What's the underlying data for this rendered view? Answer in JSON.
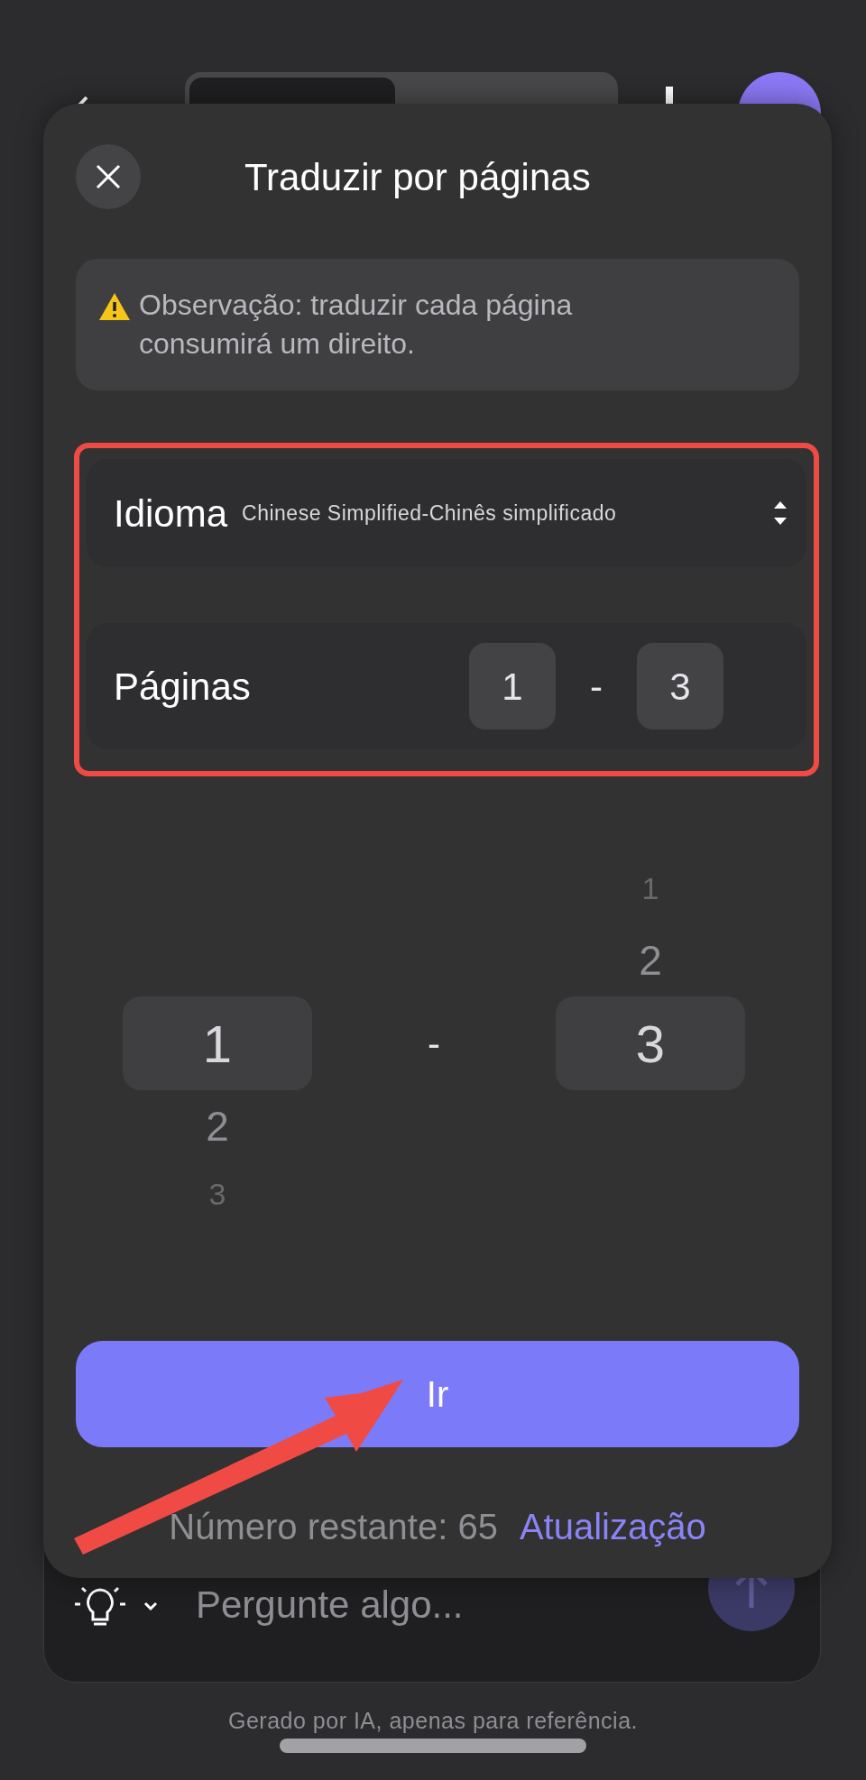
{
  "sheet": {
    "title": "Traduzir por páginas",
    "notice": "Observação: traduzir cada página consumirá um direito.",
    "language": {
      "label": "Idioma",
      "value": "Chinese Simplified-Chinês simplificado"
    },
    "pages": {
      "label": "Páginas",
      "from": "1",
      "separator": "-",
      "to": "3"
    },
    "picker": {
      "separator": "-",
      "columns": [
        {
          "items": [
            {
              "label": "1",
              "selected": true
            },
            {
              "label": "2",
              "selected": false
            },
            {
              "label": "3",
              "selected": false
            }
          ]
        },
        {
          "items": [
            {
              "label": "1",
              "selected": false
            },
            {
              "label": "2",
              "selected": false
            },
            {
              "label": "3",
              "selected": true
            }
          ]
        }
      ]
    },
    "go_button": "Ir",
    "remaining": "Número restante: 65",
    "upgrade_link": "Atualização"
  },
  "composer": {
    "placeholder": "Pergunte algo..."
  },
  "footer": "Gerado por IA, apenas para referência."
}
